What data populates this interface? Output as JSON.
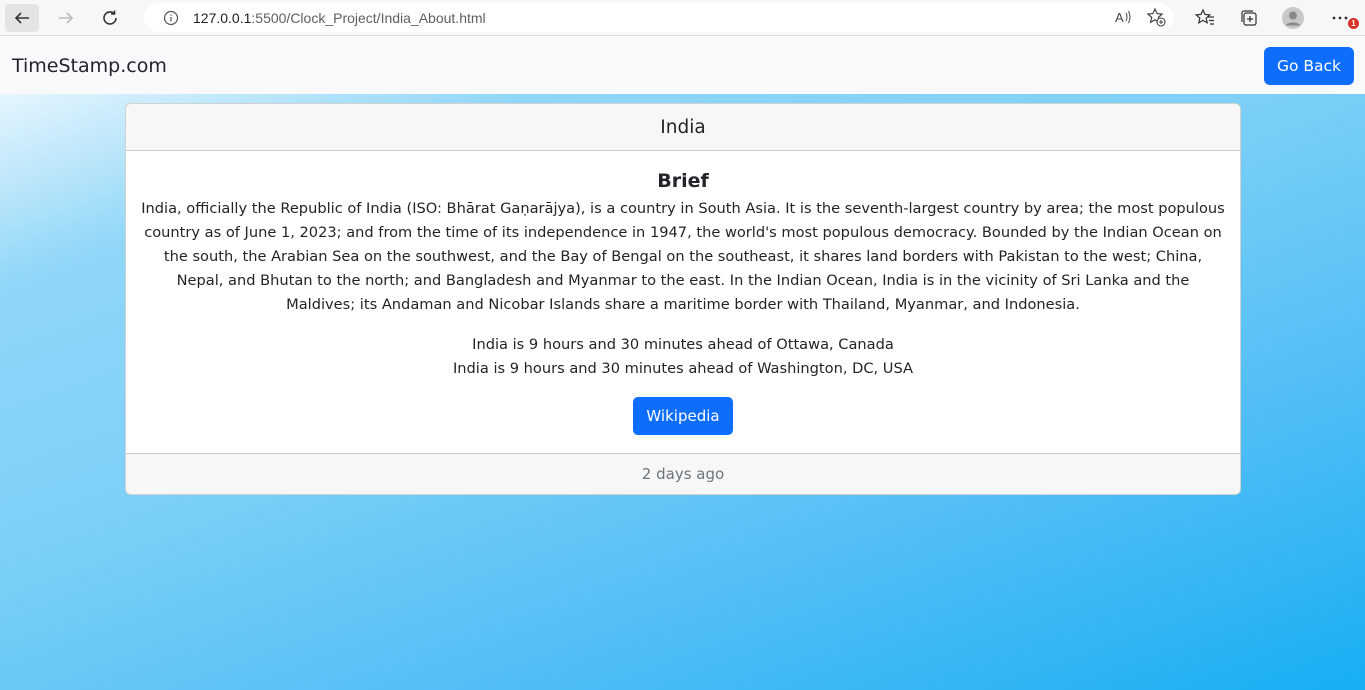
{
  "browser": {
    "url_host": "127.0.0.1",
    "url_rest": ":5500/Clock_Project/India_About.html",
    "notification_count": "1"
  },
  "navbar": {
    "brand": "TimeStamp.com",
    "go_back_label": "Go Back"
  },
  "card": {
    "header": "India",
    "title": "Brief",
    "description": "India, officially the Republic of India (ISO: Bhārat Gaṇarājya), is a country in South Asia. It is the seventh-largest country by area; the most populous country as of June 1, 2023; and from the time of its independence in 1947, the world's most populous democracy. Bounded by the Indian Ocean on the south, the Arabian Sea on the southwest, and the Bay of Bengal on the southeast, it shares land borders with Pakistan to the west; China, Nepal, and Bhutan to the north; and Bangladesh and Myanmar to the east. In the Indian Ocean, India is in the vicinity of Sri Lanka and the Maldives; its Andaman and Nicobar Islands share a maritime border with Thailand, Myanmar, and Indonesia.",
    "time_diff": [
      "India is 9 hours and 30 minutes ahead of Ottawa, Canada",
      "India is 9 hours and 30 minutes ahead of Washington, DC, USA"
    ],
    "wiki_label": "Wikipedia",
    "footer": "2 days ago"
  },
  "colors": {
    "primary_button": "#0d6efd",
    "gradient_end": "#17aef4"
  }
}
